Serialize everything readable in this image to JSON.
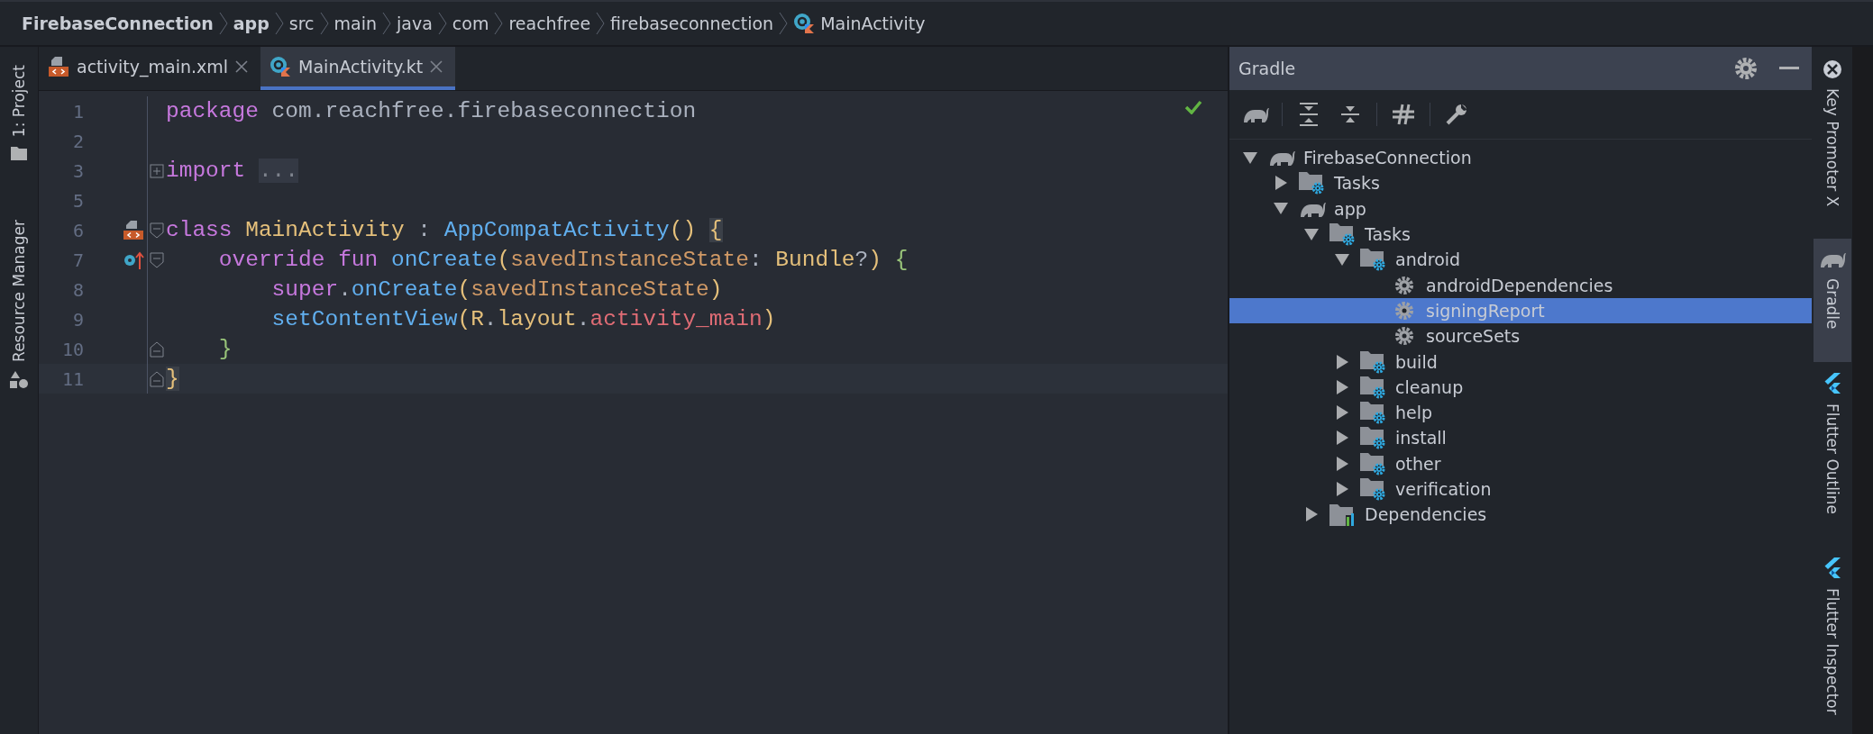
{
  "breadcrumbs": [
    {
      "label": "FirebaseConnection",
      "bold": true
    },
    {
      "label": "app",
      "bold": true
    },
    {
      "label": "src",
      "bold": false
    },
    {
      "label": "main",
      "bold": false
    },
    {
      "label": "java",
      "bold": false
    },
    {
      "label": "com",
      "bold": false
    },
    {
      "label": "reachfree",
      "bold": false
    },
    {
      "label": "firebaseconnection",
      "bold": false
    },
    {
      "label": "MainActivity",
      "bold": false
    }
  ],
  "left_strip": [
    {
      "label": "1: Project"
    },
    {
      "label": "Resource Manager"
    }
  ],
  "tabs": [
    {
      "label": "activity_main.xml",
      "kind": "xml",
      "selected": false
    },
    {
      "label": "MainActivity.kt",
      "kind": "kotlin",
      "selected": true
    }
  ],
  "editor": {
    "lines": [
      {
        "number": "1",
        "tokens": [
          {
            "kind": "keyword",
            "text": "package"
          },
          {
            "kind": "plain",
            "text": " com.reachfree.firebaseconnection"
          }
        ]
      },
      {
        "number": "2"
      },
      {
        "number": "3",
        "fold": {
          "kind": "collapsed"
        },
        "tokens": [
          {
            "kind": "keyword",
            "text": "import "
          },
          {
            "kind": "folded",
            "text": "..."
          }
        ]
      },
      {
        "number": "5"
      },
      {
        "number": "6",
        "fold": {
          "kind": "open"
        },
        "gutter": {
          "kind": "layout"
        },
        "tokens": [
          {
            "kind": "keyword",
            "text": "class"
          },
          {
            "kind": "type",
            "text": " MainActivity"
          },
          {
            "kind": "plain",
            "text": " : "
          },
          {
            "kind": "function",
            "text": "AppCompatActivity"
          },
          {
            "kind": "paren",
            "text": "() "
          },
          {
            "kind": "matched",
            "text": "{"
          }
        ]
      },
      {
        "number": "7",
        "fold": {
          "kind": "open"
        },
        "gutter": {
          "kind": "override"
        },
        "tokens": [
          {
            "kind": "keyword",
            "text": "    override fun"
          },
          {
            "kind": "function",
            "text": " onCreate"
          },
          {
            "kind": "paren",
            "text": "("
          },
          {
            "kind": "param",
            "text": "savedInstanceState"
          },
          {
            "kind": "plain",
            "text": ": "
          },
          {
            "kind": "type",
            "text": "Bundle"
          },
          {
            "kind": "plain",
            "text": "?"
          },
          {
            "kind": "paren",
            "text": ")"
          },
          {
            "kind": "brace",
            "text": " {"
          }
        ]
      },
      {
        "number": "8",
        "tokens": [
          {
            "kind": "keyword",
            "text": "        super"
          },
          {
            "kind": "plain",
            "text": "."
          },
          {
            "kind": "function",
            "text": "onCreate"
          },
          {
            "kind": "paren",
            "text": "("
          },
          {
            "kind": "param",
            "text": "savedInstanceState"
          },
          {
            "kind": "paren",
            "text": ")"
          }
        ]
      },
      {
        "number": "9",
        "tokens": [
          {
            "kind": "function",
            "text": "        setContentView"
          },
          {
            "kind": "paren",
            "text": "("
          },
          {
            "kind": "type",
            "text": "R"
          },
          {
            "kind": "plain",
            "text": "."
          },
          {
            "kind": "type",
            "text": "layout"
          },
          {
            "kind": "plain",
            "text": "."
          },
          {
            "kind": "field",
            "text": "activity_main"
          },
          {
            "kind": "paren",
            "text": ")"
          }
        ]
      },
      {
        "number": "10",
        "fold": {
          "kind": "close"
        },
        "tokens": [
          {
            "kind": "brace",
            "text": "    }"
          }
        ]
      },
      {
        "number": "11",
        "fold": {
          "kind": "close"
        },
        "current": true,
        "tokens": [
          {
            "kind": "matched",
            "text": "}"
          }
        ]
      }
    ]
  },
  "gradle": {
    "title": "Gradle",
    "tree": [
      {
        "label": "FirebaseConnection",
        "kind": "project",
        "expanded": true,
        "selected": false,
        "children": [
          {
            "label": "Tasks",
            "kind": "task-group",
            "expanded": false,
            "selected": false
          },
          {
            "label": "app",
            "kind": "project",
            "expanded": true,
            "selected": false,
            "children": [
              {
                "label": "Tasks",
                "kind": "task-group",
                "expanded": true,
                "selected": false,
                "children": [
                  {
                    "label": "android",
                    "kind": "task-group",
                    "expanded": true,
                    "selected": false,
                    "children": [
                      {
                        "label": "androidDependencies",
                        "kind": "task",
                        "selected": false
                      },
                      {
                        "label": "signingReport",
                        "kind": "task",
                        "selected": true
                      },
                      {
                        "label": "sourceSets",
                        "kind": "task",
                        "selected": false
                      }
                    ]
                  },
                  {
                    "label": "build",
                    "kind": "task-group",
                    "expanded": false,
                    "selected": false
                  },
                  {
                    "label": "cleanup",
                    "kind": "task-group",
                    "expanded": false,
                    "selected": false
                  },
                  {
                    "label": "help",
                    "kind": "task-group",
                    "expanded": false,
                    "selected": false
                  },
                  {
                    "label": "install",
                    "kind": "task-group",
                    "expanded": false,
                    "selected": false
                  },
                  {
                    "label": "other",
                    "kind": "task-group",
                    "expanded": false,
                    "selected": false
                  },
                  {
                    "label": "verification",
                    "kind": "task-group",
                    "expanded": false,
                    "selected": false
                  }
                ]
              },
              {
                "label": "Dependencies",
                "kind": "dependencies",
                "expanded": false,
                "selected": false
              }
            ]
          }
        ]
      }
    ]
  },
  "right_strip": [
    {
      "label": "Key Promoter X",
      "selected": false
    },
    {
      "label": "Gradle",
      "selected": true
    },
    {
      "label": "Flutter Outline",
      "selected": false
    },
    {
      "label": "Flutter Inspector",
      "selected": false
    }
  ]
}
